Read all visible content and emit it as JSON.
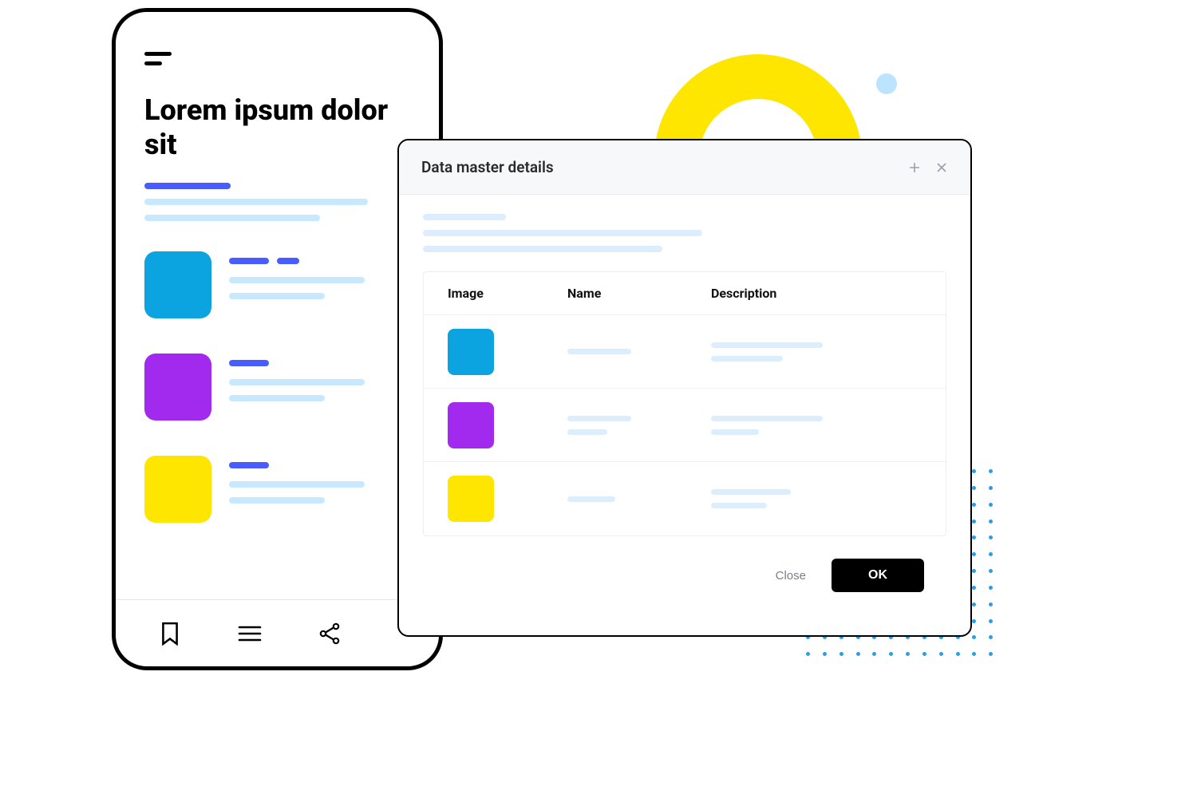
{
  "phone": {
    "title": "Lorem ipsum dolor sit",
    "items": [
      {
        "color": "cyan"
      },
      {
        "color": "purple"
      },
      {
        "color": "yellow"
      }
    ]
  },
  "modal": {
    "title": "Data master details",
    "columns": {
      "image": "Image",
      "name": "Name",
      "description": "Description"
    },
    "rows": [
      {
        "color": "cyan"
      },
      {
        "color": "purple"
      },
      {
        "color": "yellow"
      }
    ],
    "buttons": {
      "close": "Close",
      "ok": "OK"
    }
  }
}
